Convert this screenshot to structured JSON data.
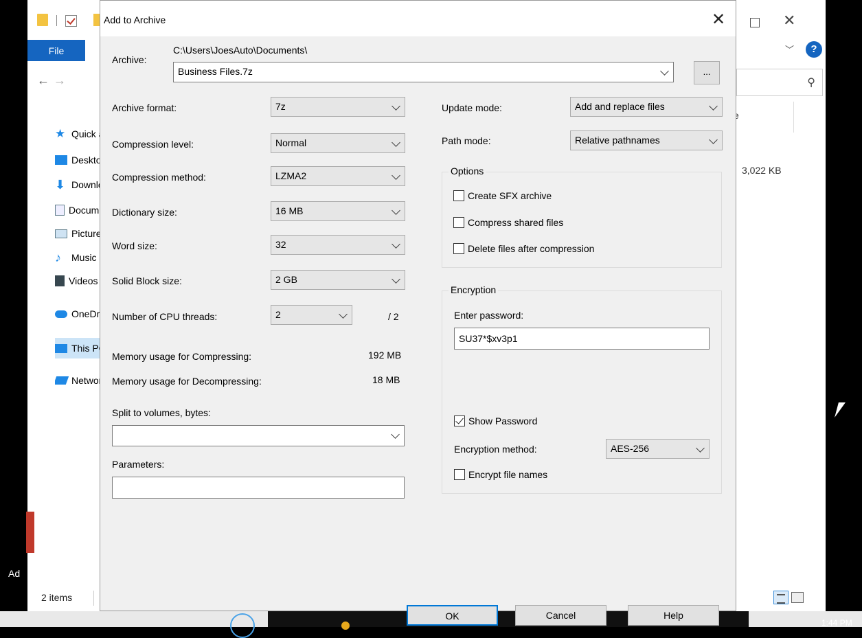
{
  "explorer": {
    "file_tab": "File",
    "nav": [
      {
        "label": "Quick access",
        "icon": "star-icon",
        "color": "#1e88e5"
      },
      {
        "label": "Desktop",
        "icon": "desktop-icon",
        "color": "#1e88e5"
      },
      {
        "label": "Downloads",
        "icon": "download-icon",
        "color": "#1e88e5"
      },
      {
        "label": "Documents",
        "icon": "document-icon",
        "color": "#607d8b"
      },
      {
        "label": "Pictures",
        "icon": "pictures-icon",
        "color": "#607d8b"
      },
      {
        "label": "Music",
        "icon": "music-icon",
        "color": "#1e88e5"
      },
      {
        "label": "Videos",
        "icon": "video-icon",
        "color": "#37474f"
      },
      {
        "label": "OneDrive",
        "icon": "cloud-icon",
        "color": "#1e88e5"
      },
      {
        "label": "This PC",
        "icon": "computer-icon",
        "color": "#1e88e5"
      },
      {
        "label": "Network",
        "icon": "network-icon",
        "color": "#1e88e5"
      }
    ],
    "column_partial": "e",
    "file_size": "3,022 KB",
    "status_items": "2 items",
    "desktop_label": "Ad"
  },
  "taskbar": {
    "clock": "1:44 PM"
  },
  "dialog": {
    "title": "Add to Archive",
    "archive_label": "Archive:",
    "archive_path": "C:\\Users\\JoesAuto\\Documents\\",
    "archive_name": "Business Files.7z",
    "browse_label": "...",
    "left": {
      "rows": [
        {
          "label": "Archive format:",
          "value": "7z"
        },
        {
          "label": "Compression level:",
          "value": "Normal"
        },
        {
          "label": "Compression method:",
          "value": "LZMA2"
        },
        {
          "label": "Dictionary size:",
          "value": "16 MB"
        },
        {
          "label": "Word size:",
          "value": "32"
        },
        {
          "label": "Solid Block size:",
          "value": "2 GB"
        }
      ],
      "cpu_label": "Number of CPU threads:",
      "cpu_value": "2",
      "cpu_max": "/ 2",
      "mem_comp_label": "Memory usage for Compressing:",
      "mem_comp_value": "192 MB",
      "mem_decomp_label": "Memory usage for Decompressing:",
      "mem_decomp_value": "18 MB",
      "split_label": "Split to volumes, bytes:",
      "split_value": "",
      "params_label": "Parameters:",
      "params_value": ""
    },
    "right": {
      "update_label": "Update mode:",
      "update_value": "Add and replace files",
      "path_label": "Path mode:",
      "path_value": "Relative pathnames",
      "options_legend": "Options",
      "options": [
        {
          "label": "Create SFX archive",
          "checked": false
        },
        {
          "label": "Compress shared files",
          "checked": false
        },
        {
          "label": "Delete files after compression",
          "checked": false
        }
      ],
      "encryption_legend": "Encryption",
      "password_label": "Enter password:",
      "password_value": "SU37*$xv3p1",
      "show_password_label": "Show Password",
      "show_password_checked": true,
      "enc_method_label": "Encryption method:",
      "enc_method_value": "AES-256",
      "encrypt_names_label": "Encrypt file names",
      "encrypt_names_checked": false
    },
    "buttons": {
      "ok": "OK",
      "cancel": "Cancel",
      "help": "Help"
    }
  }
}
